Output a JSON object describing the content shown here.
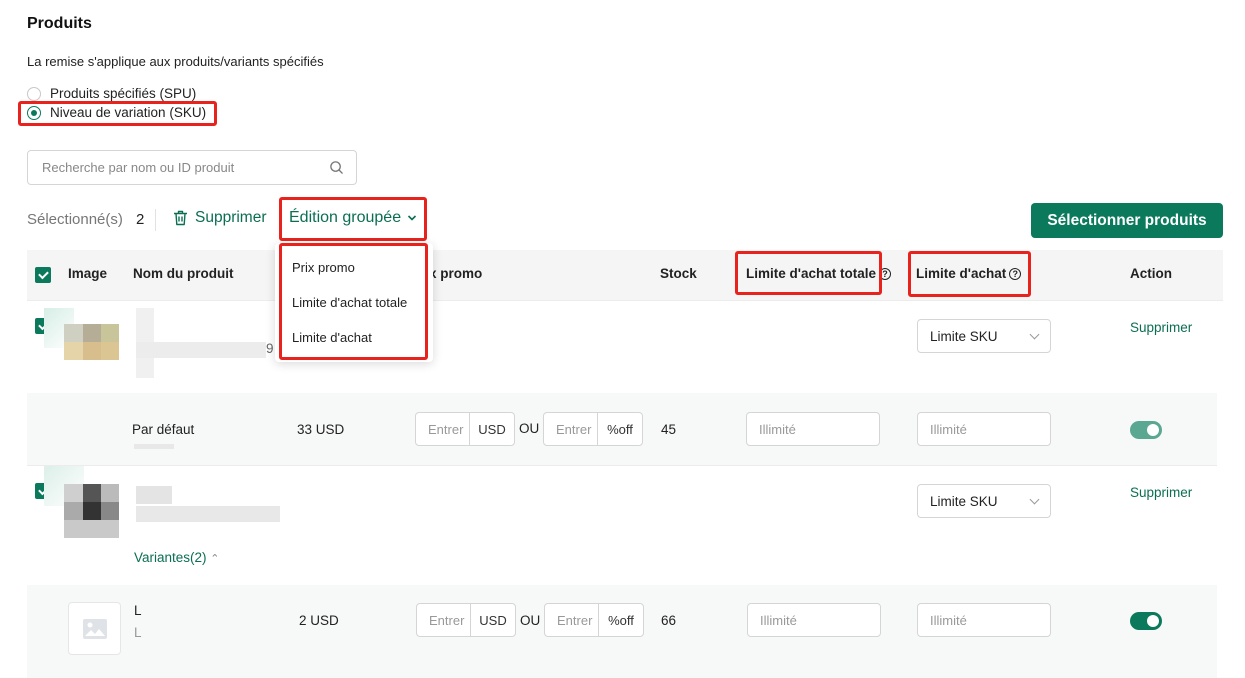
{
  "section": {
    "title": "Produits",
    "description": "La remise s'applique aux produits/variants spécifiés"
  },
  "scope_options": [
    {
      "label": "Produits spécifiés (SPU)",
      "selected": false
    },
    {
      "label": "Niveau de variation (SKU)",
      "selected": true
    }
  ],
  "search": {
    "placeholder": "Recherche par nom ou ID produit",
    "icon": "search-icon"
  },
  "toolbar": {
    "selected_label": "Sélectionné(s)",
    "selected_count": "2",
    "delete_label": "Supprimer",
    "group_edit_label": "Édition groupée",
    "select_products_label": "Sélectionner produits"
  },
  "group_edit_menu": [
    "Prix promo",
    "Limite d'achat totale",
    "Limite d'achat"
  ],
  "table": {
    "headers": {
      "image": "Image",
      "name": "Nom du produit",
      "promo_price": "x promo",
      "stock": "Stock",
      "total_limit": "Limite d'achat totale",
      "limit": "Limite d'achat",
      "action": "Action"
    },
    "products": [
      {
        "name_fragment": "9",
        "limit_select": "Limite SKU",
        "action": "Supprimer",
        "variants": [
          {
            "name": "Par défaut",
            "price": "33 USD",
            "promo_amount_placeholder": "Entrer",
            "currency": "USD",
            "or_label": "OU",
            "promo_percent_placeholder": "Entrer",
            "percent_unit": "%off",
            "stock": "45",
            "total_limit_placeholder": "Illimité",
            "limit_placeholder": "Illimité",
            "enabled": true
          }
        ]
      },
      {
        "variants_label": "Variantes(2)",
        "limit_select": "Limite SKU",
        "action": "Supprimer",
        "variants": [
          {
            "name": "L",
            "sub_name": "L",
            "price": "2 USD",
            "promo_amount_placeholder": "Entrer",
            "currency": "USD",
            "or_label": "OU",
            "promo_percent_placeholder": "Entrer",
            "percent_unit": "%off",
            "stock": "66",
            "total_limit_placeholder": "Illimité",
            "limit_placeholder": "Illimité",
            "enabled": true
          }
        ]
      }
    ]
  },
  "colors": {
    "accent": "#0b7a5c",
    "toggle_light": "#5aa892",
    "highlight": "#e8231e"
  }
}
